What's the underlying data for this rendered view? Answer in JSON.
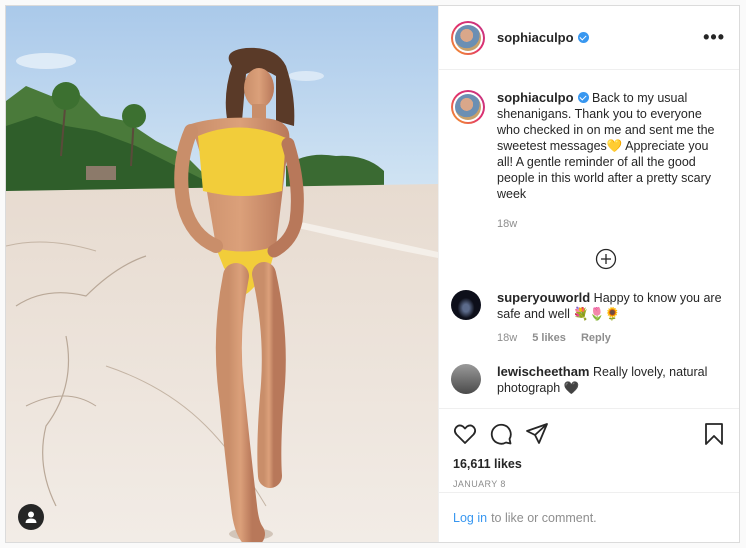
{
  "post": {
    "username": "sophiaculpo",
    "more_label": "•••",
    "caption_user": "sophiaculpo",
    "caption_text": "Back to my usual shenanigans. Thank you to everyone who checked in on me and sent me the sweetest messages💛 Appreciate you all! A gentle reminder of all the good people in this world after a pretty scary week",
    "caption_time": "18w",
    "likes": "16,611 likes",
    "date": "JANUARY 8"
  },
  "comments": [
    {
      "user": "superyouworld",
      "text": "Happy to know you are safe and well 💐🌷🌻",
      "time": "18w",
      "likes": "5 likes",
      "reply": "Reply"
    },
    {
      "user": "lewischeetham",
      "text": "Really lovely, natural photograph 🖤"
    }
  ],
  "footer": {
    "login_link": "Log in",
    "login_text": "to like or comment."
  },
  "colors": {
    "link": "#3897f0",
    "verified": "#3897f0",
    "muted": "#8e8e8e"
  },
  "icons": [
    "user-tag-icon",
    "verified-icon",
    "more-options-icon",
    "load-more-icon",
    "heart-icon",
    "comment-icon",
    "share-icon",
    "bookmark-icon"
  ]
}
